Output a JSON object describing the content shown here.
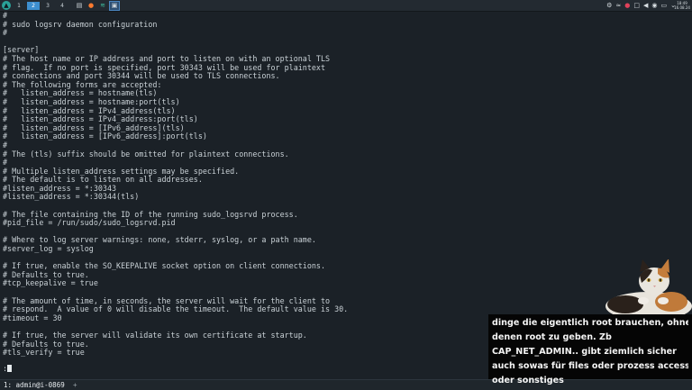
{
  "panel": {
    "launcher_icon": "arch-launcher-icon",
    "workspaces": [
      {
        "label": "1",
        "active": false
      },
      {
        "label": "2",
        "active": true
      },
      {
        "label": "3",
        "active": false
      },
      {
        "label": "4",
        "active": false
      }
    ],
    "apps": [
      {
        "name": "file-manager-icon",
        "glyph": "▤"
      },
      {
        "name": "firefox-icon",
        "glyph": "●"
      },
      {
        "name": "settings-icon",
        "glyph": "≋"
      },
      {
        "name": "terminal-app-icon",
        "glyph": "▣"
      }
    ],
    "tray": [
      {
        "name": "steam-icon",
        "glyph": "⚙"
      },
      {
        "name": "network-icon",
        "glyph": "≈"
      },
      {
        "name": "notification-icon",
        "glyph": "●"
      },
      {
        "name": "clipboard-icon",
        "glyph": "□"
      },
      {
        "name": "volume-icon",
        "glyph": "◀"
      },
      {
        "name": "record-icon",
        "glyph": "◉"
      },
      {
        "name": "display-icon",
        "glyph": "▭"
      },
      {
        "name": "expand-icon",
        "glyph": "⌄"
      }
    ],
    "clock_time": "18:49",
    "clock_date": "16.08.24"
  },
  "terminal": {
    "lines": [
      "#",
      "# sudo logsrv daemon configuration",
      "#",
      "",
      "[server]",
      "# The host name or IP address and port to listen on with an optional TLS",
      "# flag.  If no port is specified, port 30343 will be used for plaintext",
      "# connections and port 30344 will be used to TLS connections.",
      "# The following forms are accepted:",
      "#   listen_address = hostname(tls)",
      "#   listen_address = hostname:port(tls)",
      "#   listen_address = IPv4_address(tls)",
      "#   listen_address = IPv4_address:port(tls)",
      "#   listen_address = [IPv6_address](tls)",
      "#   listen_address = [IPv6_address]:port(tls)",
      "#",
      "# The (tls) suffix should be omitted for plaintext connections.",
      "#",
      "# Multiple listen_address settings may be specified.",
      "# The default is to listen on all addresses.",
      "#listen_address = *:30343",
      "#listen_address = *:30344(tls)",
      "",
      "# The file containing the ID of the running sudo_logsrvd process.",
      "#pid_file = /run/sudo/sudo_logsrvd.pid",
      "",
      "# Where to log server warnings: none, stderr, syslog, or a path name.",
      "#server_log = syslog",
      "",
      "# If true, enable the SO_KEEPALIVE socket option on client connections.",
      "# Defaults to true.",
      "#tcp_keepalive = true",
      "",
      "# The amount of time, in seconds, the server will wait for the client to",
      "# respond.  A value of 0 will disable the timeout.  The default value is 30.",
      "#timeout = 30",
      "",
      "# If true, the server will validate its own certificate at startup.",
      "# Defaults to true.",
      "#tls_verify = true"
    ],
    "prompt": ":"
  },
  "statusbar": {
    "window_label": "1: admin@i-0869",
    "extra": "+"
  },
  "overlay": {
    "caption_lines": [
      "dinge die eigentlich root brauchen, ohne",
      "denen root zu geben. Zb",
      "CAP_NET_ADMIN.. gibt ziemlich sicher",
      "auch sowas für files oder prozess access",
      "oder sonstiges"
    ]
  },
  "colors": {
    "terminal_bg": "#1b2127",
    "terminal_fg": "#c9d1d6",
    "workspace_active": "#3d8fd0",
    "caption_bg": "#050505"
  }
}
